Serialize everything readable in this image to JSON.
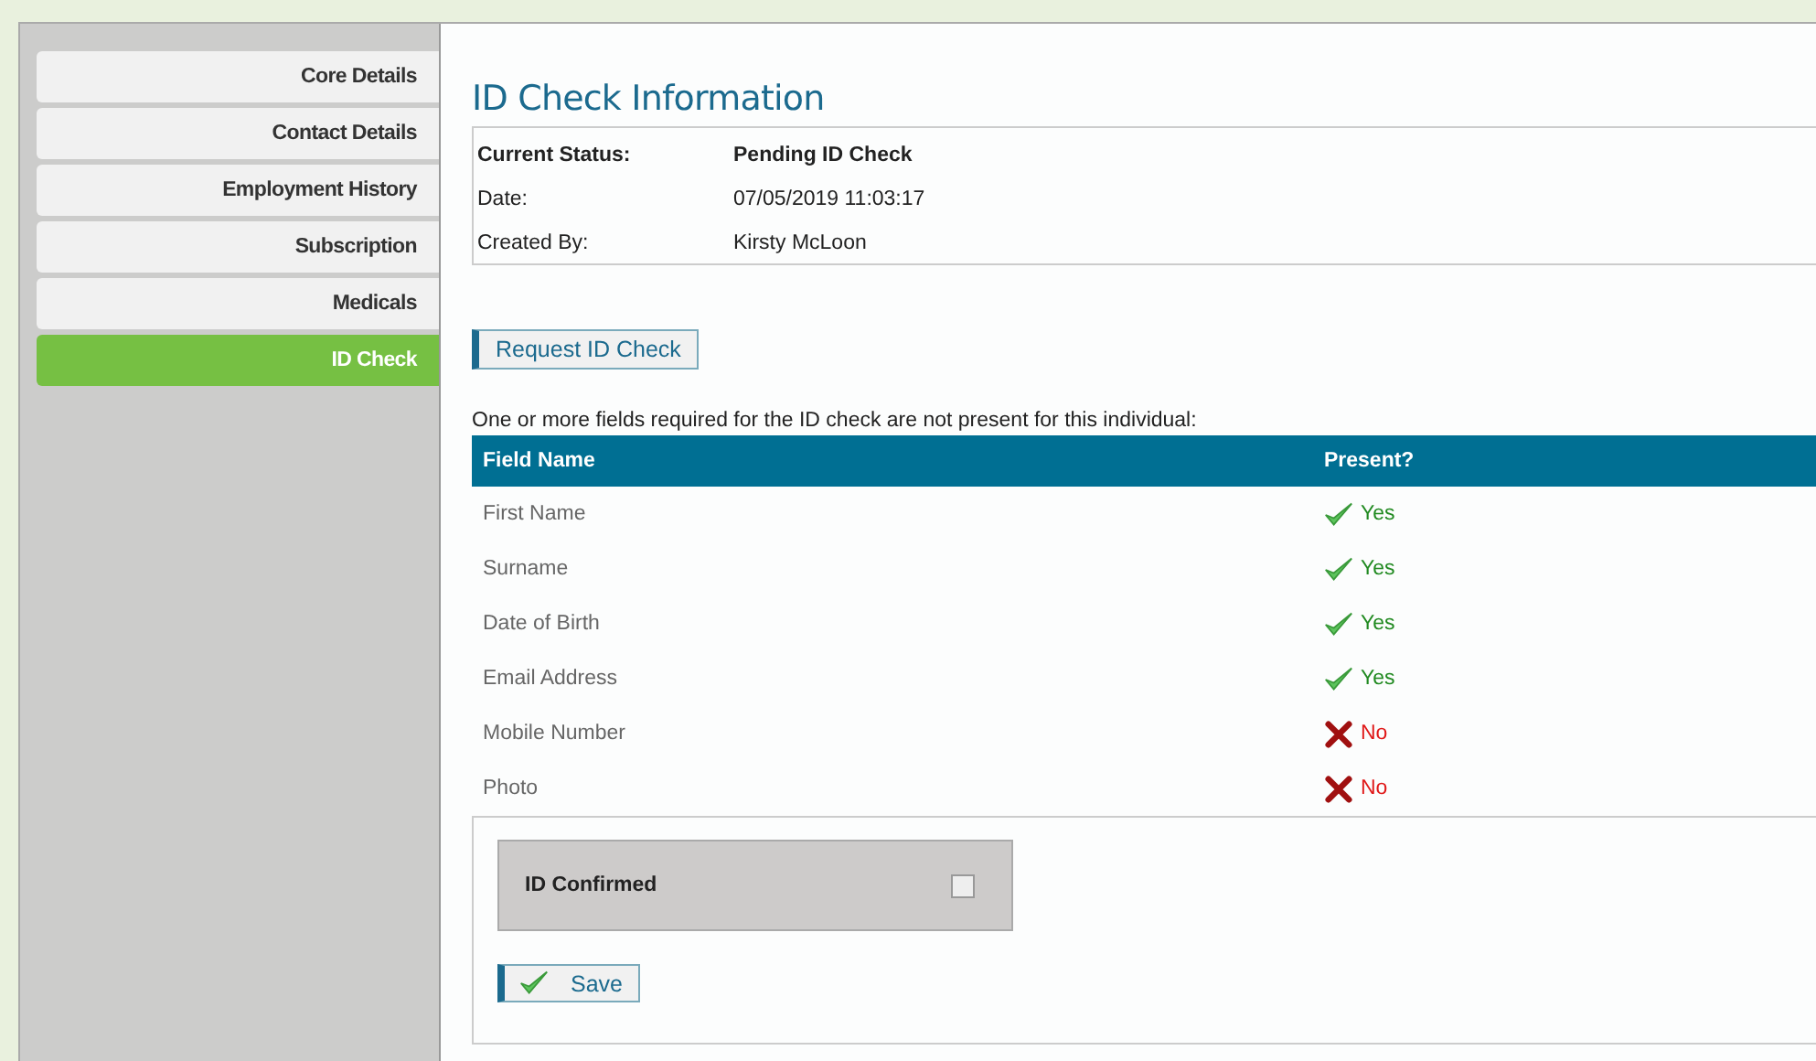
{
  "sidebar": {
    "items": [
      {
        "label": "Core Details",
        "selected": false
      },
      {
        "label": "Contact Details",
        "selected": false
      },
      {
        "label": "Employment History",
        "selected": false
      },
      {
        "label": "Subscription",
        "selected": false
      },
      {
        "label": "Medicals",
        "selected": false
      },
      {
        "label": "ID Check",
        "selected": true
      }
    ]
  },
  "title": "ID Check Information",
  "info": [
    {
      "label": "Current Status:",
      "value": "Pending ID Check",
      "bold": true
    },
    {
      "label": "Date:",
      "value": "07/05/2019 11:03:17",
      "bold": false
    },
    {
      "label": "Created By:",
      "value": "Kirsty McLoon",
      "bold": false
    }
  ],
  "request_button": "Request ID Check",
  "message": "One or more fields required for the ID check are not present for this individual:",
  "table": {
    "columns": [
      "Field Name",
      "Present?"
    ],
    "rows": [
      {
        "field": "First Name",
        "present": true,
        "answer": "Yes"
      },
      {
        "field": "Surname",
        "present": true,
        "answer": "Yes"
      },
      {
        "field": "Date of Birth",
        "present": true,
        "answer": "Yes"
      },
      {
        "field": "Email Address",
        "present": true,
        "answer": "Yes"
      },
      {
        "field": "Mobile Number",
        "present": false,
        "answer": "No"
      },
      {
        "field": "Photo",
        "present": false,
        "answer": "No"
      }
    ]
  },
  "confirm": {
    "label": "ID Confirmed",
    "checked": false
  },
  "save_button": "Save"
}
